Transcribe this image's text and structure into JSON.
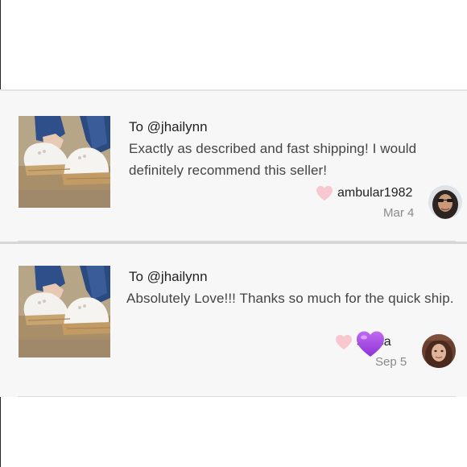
{
  "reviews": [
    {
      "to": "To @jhailynn",
      "comment": "Exactly as described and fast shipping! I would definitely recommend this seller!",
      "username": "ambular1982",
      "date": "Mar 4",
      "thumbnail_icon": "sneaker-photo",
      "like_icon": "heart-icon"
    },
    {
      "to": "To @jhailynn",
      "comment": "Absolutely Love!!! Thanks so much for the quick ship.",
      "username": "s mca",
      "date": "Sep 5",
      "thumbnail_icon": "sneaker-photo",
      "like_icon": "heart-icon",
      "overlay_icon": "purple-heart-emoji"
    }
  ],
  "colors": {
    "heart_pink": "#f8c8d0",
    "overlay_purple": "#a24be6",
    "card_background": "#f7f7f7",
    "text_primary": "#222222",
    "text_secondary": "#8a8a8a"
  }
}
